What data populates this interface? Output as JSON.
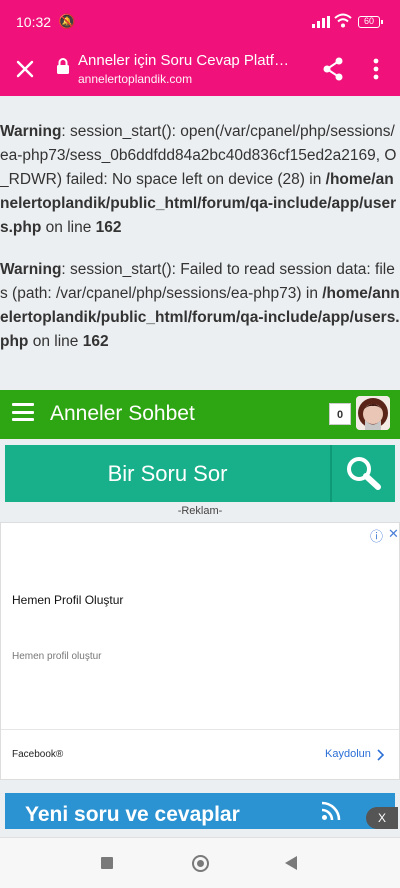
{
  "status_bar": {
    "time": "10:32",
    "mute_glyph": "🔕",
    "battery": "60"
  },
  "browser": {
    "title": "Anneler için Soru Cevap Platf…",
    "url": "annelertoplandik.com"
  },
  "warnings": [
    {
      "label": "Warning",
      "message": ": session_start(): open(/var/cpanel/php/sessions/ea-php73/sess_0b6ddfdd84a2bc40d836cf15ed2a2169, O_RDWR) failed: No space left on device (28) in ",
      "path": "/home/annelertoplandik/public_html/forum/qa-include/app/users.php",
      "on_line": " on line ",
      "line": "162"
    },
    {
      "label": "Warning",
      "message": ": session_start(): Failed to read session data: files (path: /var/cpanel/php/sessions/ea-php73) in ",
      "path": "/home/annelertoplandik/public_html/forum/qa-include/app/users.php",
      "on_line": " on line ",
      "line": "162"
    }
  ],
  "site_header": {
    "title": "Anneler Sohbet",
    "notification_count": "0"
  },
  "ask": {
    "label": "Bir Soru Sor"
  },
  "ad_label": "-Reklam-",
  "ad": {
    "headline": "Hemen Profil Oluştur",
    "body": "Hemen profil oluştur",
    "advertiser": "Facebook®",
    "cta": "Kaydolun"
  },
  "feed": {
    "title": "Yeni soru ve cevaplar"
  },
  "dismiss": {
    "label": "X"
  },
  "colors": {
    "browser_bar": "#f0127a",
    "site_header": "#2ea512",
    "ask_bar": "#18b08a",
    "feed_banner": "#2c93d3"
  },
  "icons": {
    "close": "close-icon",
    "lock": "lock-icon",
    "share": "share-icon",
    "menu": "more-vert-icon",
    "hamburger": "hamburger-icon",
    "search": "search-icon",
    "rss": "rss-icon",
    "adchoices": "adchoices-icon",
    "chevron": "chevron-right-icon"
  }
}
